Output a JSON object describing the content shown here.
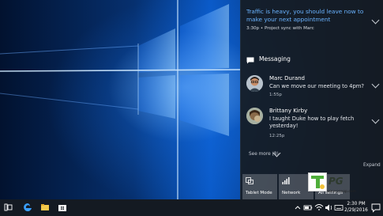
{
  "notification_top": {
    "message": "Traffic is heavy, you should leave now to make your next appointment",
    "subtext": "3:30p • Project sync with Marc"
  },
  "messaging": {
    "title": "Messaging",
    "toasts": [
      {
        "name": "Marc Durand",
        "text": "Can we move our meeting to 4pm?",
        "time": "1:55p"
      },
      {
        "name": "Brittany Kirby",
        "text": "I taught Duke how to play fetch yesterday!",
        "time": "12:25p"
      }
    ],
    "see_more": "See more (8)"
  },
  "expand_label": "Expand",
  "quick_actions": [
    {
      "label": "Tablet Mode",
      "icon": "tablet-mode-icon"
    },
    {
      "label": "Network",
      "icon": "network-icon"
    },
    {
      "label": "All settings",
      "icon": "settings-icon"
    }
  ],
  "watermark": {
    "mark": "T",
    "text": "PG",
    "url": "www.pcpop.com"
  },
  "taskbar": {
    "time": "2:30 PM",
    "date": "2/29/2016"
  },
  "colors": {
    "accent": "#6ab3ff",
    "taskbar": "#141a22",
    "panel": "#161c24"
  }
}
